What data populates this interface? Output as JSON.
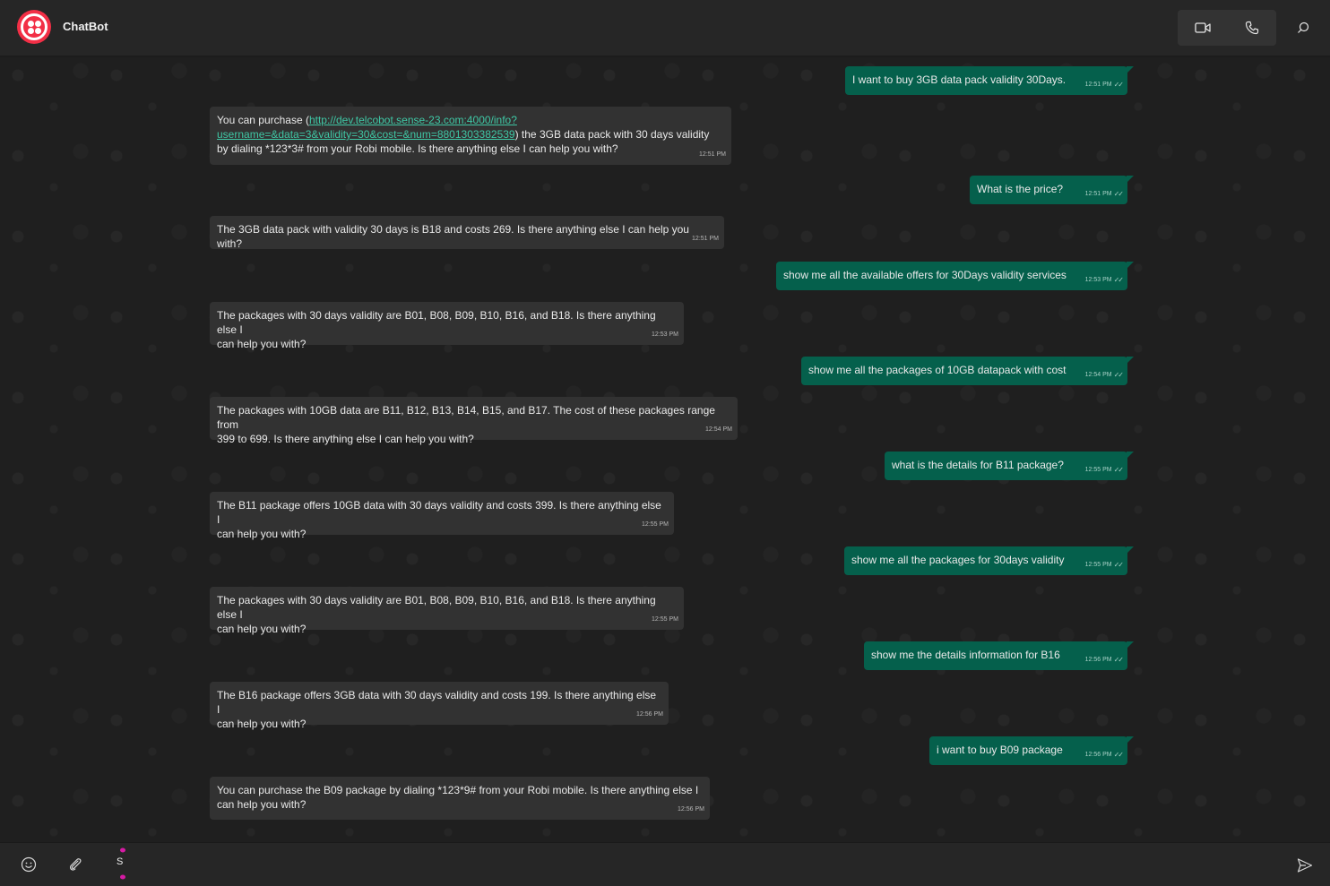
{
  "header": {
    "title": "ChatBot",
    "icons": [
      "twilio-logo",
      "video-camera-icon",
      "phone-icon",
      "search-icon"
    ]
  },
  "messages": [
    {
      "dir": "out",
      "text": "I want to buy 3GB data pack validity 30Days.",
      "time": "12:51 PM"
    },
    {
      "dir": "in",
      "text_before": "You can purchase (",
      "link": "http://dev.telcobot.sense-23.com:4000/info?username=&data=3&validity=30&cost=&num=8801303382539",
      "link_line1": "http://dev.telcobot.sense-23.com:4000/info?",
      "link_line2": "username=&data=3&validity=30&cost=&num=8801303382539",
      "text_after": ") the 3GB data pack with 30 days validity",
      "text_line3": "by dialing *123*3# from your Robi mobile. Is there anything else I can help you with?",
      "time": "12:51 PM"
    },
    {
      "dir": "out",
      "text": "What is the price?",
      "time": "12:51 PM"
    },
    {
      "dir": "in",
      "text": "The 3GB data pack with validity 30 days is B18 and costs 269. Is there anything else I can help you with?",
      "time": "12:51 PM"
    },
    {
      "dir": "out",
      "text": "show me all the available offers for 30Days validity services",
      "time": "12:53 PM"
    },
    {
      "dir": "in",
      "line1": "The packages with 30 days validity are B01, B08, B09, B10, B16, and B18. Is there anything else I",
      "line2": "can help you with?",
      "time": "12:53 PM"
    },
    {
      "dir": "out",
      "text": "show me all the packages of 10GB datapack with cost",
      "time": "12:54 PM"
    },
    {
      "dir": "in",
      "line1": "The packages with 10GB data are B11, B12, B13, B14, B15, and B17. The cost of these packages range from",
      "line2": "399 to 699. Is there anything else I can help you with?",
      "time": "12:54 PM"
    },
    {
      "dir": "out",
      "text": "what is the details for B11 package?",
      "time": "12:55 PM"
    },
    {
      "dir": "in",
      "line1": "The B11 package offers 10GB data with 30 days validity and costs 399. Is there anything else I",
      "line2": "can help you with?",
      "time": "12:55 PM"
    },
    {
      "dir": "out",
      "text": "show me all the packages for 30days validity",
      "time": "12:55 PM"
    },
    {
      "dir": "in",
      "line1": "The packages with 30 days validity are B01, B08, B09, B10, B16, and B18. Is there anything else I",
      "line2": "can help you with?",
      "time": "12:55 PM"
    },
    {
      "dir": "out",
      "text": "show me the details information for B16",
      "time": "12:56 PM"
    },
    {
      "dir": "in",
      "line1": "The B16 package offers 3GB data with 30 days validity and costs 199. Is there anything else I",
      "line2": "can help you with?",
      "time": "12:56 PM"
    },
    {
      "dir": "out",
      "text": "i want to buy B09 package",
      "time": "12:56 PM"
    },
    {
      "dir": "in",
      "line1": "You can purchase the B09 package by dialing *123*9# from your Robi mobile. Is there anything else I",
      "line2": "can help you with?",
      "time": "12:56 PM"
    }
  ],
  "composer": {
    "icons": [
      "emoji-icon",
      "attachment-icon",
      "grammarly-icon",
      "send-icon"
    ],
    "badge_letter": "S"
  },
  "colors": {
    "outgoing_bubble": "#05604c",
    "incoming_bubble": "#323232",
    "link": "#3fc7a5",
    "logo": "#f22f46"
  }
}
